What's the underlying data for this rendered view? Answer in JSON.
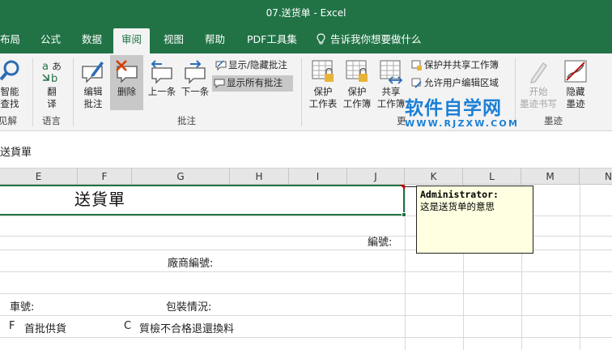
{
  "titlebar": {
    "title": "07.送货单  -  Excel"
  },
  "tabs": [
    {
      "label": "布局"
    },
    {
      "label": "公式"
    },
    {
      "label": "数据"
    },
    {
      "label": "审阅"
    },
    {
      "label": "视图"
    },
    {
      "label": "帮助"
    },
    {
      "label": "PDF工具集"
    }
  ],
  "tell_me": "告诉我你想要做什么",
  "ribbon": {
    "smart_lookup": "智能\n查找",
    "translate": "翻\n译",
    "edit_comment": "编辑\n批注",
    "delete": "删除",
    "previous": "上一条",
    "next": "下一条",
    "show_hide_comment": "显示/隐藏批注",
    "show_all_comments": "显示所有批注",
    "protect_sheet": "保护\n工作表",
    "protect_workbook": "保护\n工作簿",
    "share_workbook": "共享\n工作簿",
    "protect_share_workbook": "保护并共享工作簿",
    "allow_edit_ranges": "允许用户编辑区域",
    "start_inking": "开始\n墨迹书写",
    "hide_ink": "隐藏\n墨迹",
    "groups": {
      "insights": "见解",
      "language": "语言",
      "comments": "批注",
      "changes": "更",
      "ink": "墨迹"
    }
  },
  "watermark": {
    "cn": "软件自学网",
    "url": "WWW.RJZXW.COM"
  },
  "formula_bar": {
    "text": "送貨單"
  },
  "columns": [
    "E",
    "F",
    "G",
    "H",
    "I",
    "J",
    "K",
    "L",
    "M",
    "N"
  ],
  "cells": {
    "title": "送貨單",
    "number_label": "編號:",
    "vendor_label": "廠商編號:",
    "vehicle_label": "車號:",
    "packing_label": "包裝情況:",
    "f_code": "F",
    "f_text": "首批供貨",
    "c_code": "C",
    "c_text": "質檢不合格退還換料"
  },
  "comment": {
    "author": "Administrator:",
    "body": "这是送货单的意思"
  }
}
